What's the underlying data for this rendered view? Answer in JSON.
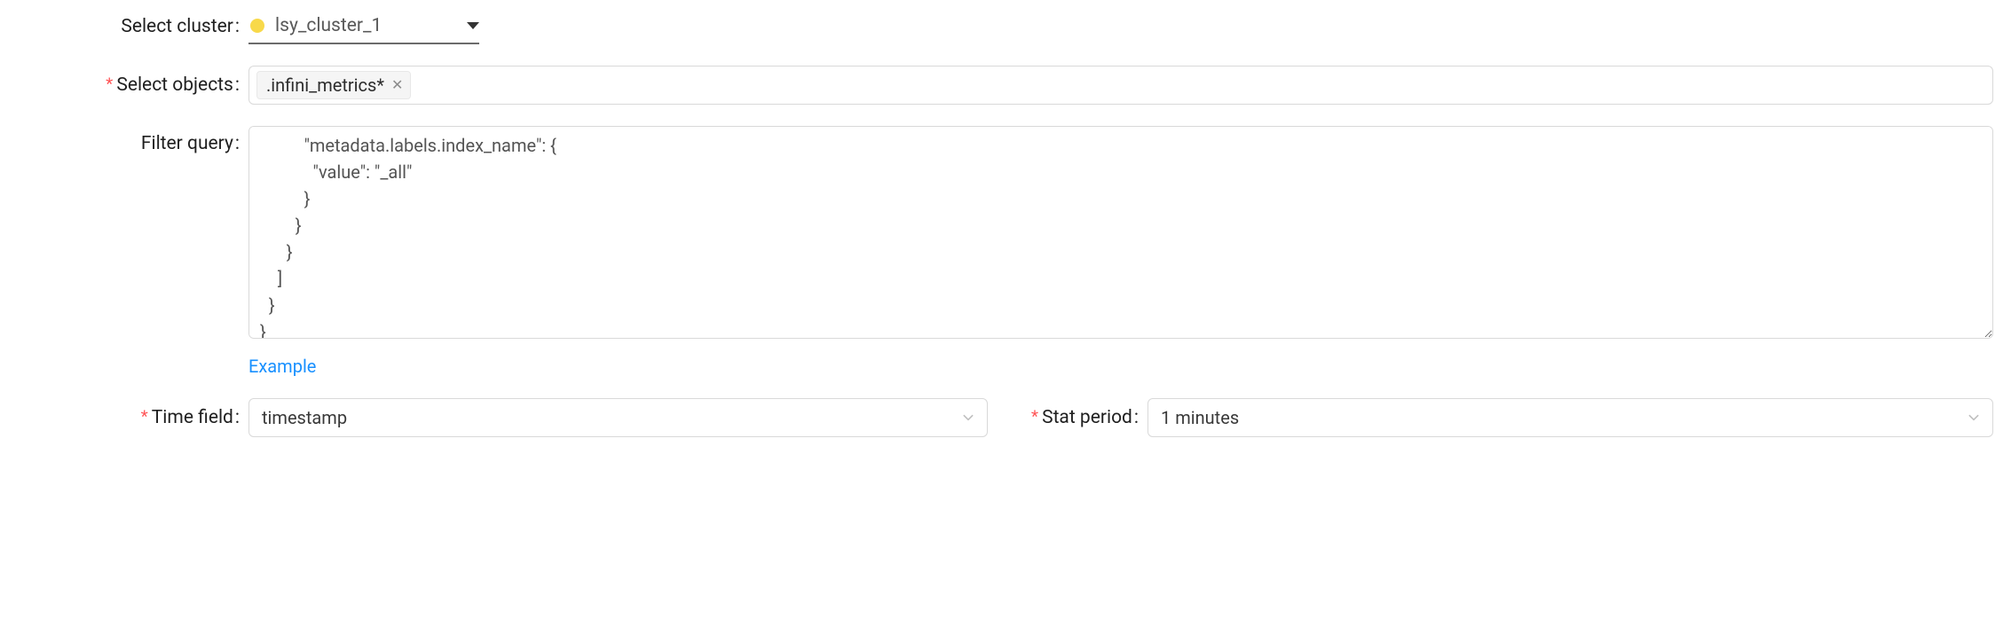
{
  "labels": {
    "select_cluster": "Select cluster",
    "select_objects": "Select objects",
    "filter_query": "Filter query",
    "time_field": "Time field",
    "stat_period": "Stat period",
    "example": "Example",
    "colon": ":"
  },
  "cluster": {
    "status_color": "#f8d94a",
    "name": "lsy_cluster_1"
  },
  "objects": {
    "tags": [
      {
        "label": ".infini_metrics*"
      }
    ]
  },
  "filter_query": {
    "value": "          \"metadata.labels.index_name\": {\n            \"value\": \"_all\"\n          }\n        }\n      }\n    ]\n  }\n}"
  },
  "time_field": {
    "value": "timestamp"
  },
  "stat_period": {
    "value": "1 minutes"
  }
}
